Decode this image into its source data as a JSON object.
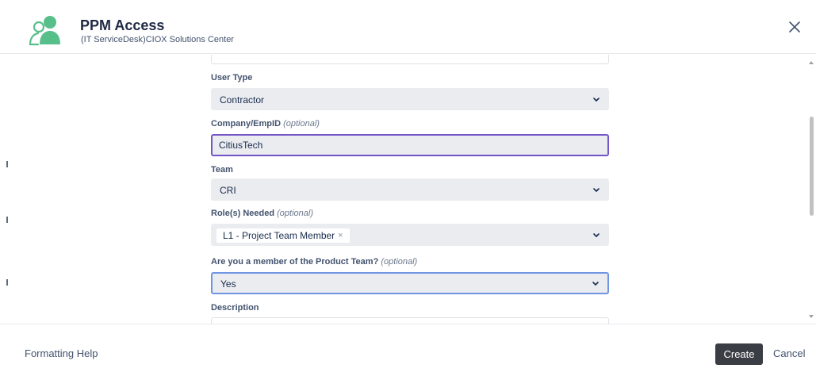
{
  "header": {
    "title": "PPM Access",
    "subtitle": "(IT ServiceDesk)CIOX Solutions Center",
    "close_icon": "close-icon"
  },
  "form": {
    "user_type": {
      "label": "User Type",
      "value": "Contractor"
    },
    "company": {
      "label": "Company/EmpID",
      "optional": "(optional)",
      "value": "CitiusTech"
    },
    "team": {
      "label": "Team",
      "value": "CRI"
    },
    "roles": {
      "label": "Role(s) Needed",
      "optional": "(optional)",
      "tags": [
        "L1 - Project Team Member"
      ],
      "remove_glyph": "×"
    },
    "product_team": {
      "label": "Are you a member of the Product Team?",
      "optional": "(optional)",
      "value": "Yes"
    },
    "description": {
      "label": "Description"
    }
  },
  "footer": {
    "help": "Formatting Help",
    "create": "Create",
    "cancel": "Cancel"
  },
  "colors": {
    "logo": "#57c08a",
    "focus_purple": "#7455c8",
    "focus_blue": "#6f95e3",
    "primary_button": "#3a3d43"
  }
}
